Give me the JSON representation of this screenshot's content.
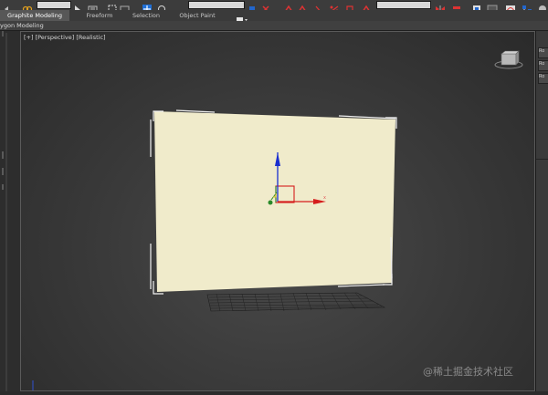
{
  "ribbon": {
    "tabs": [
      {
        "label": "Graphite Modeling Tools",
        "active": true
      },
      {
        "label": "Freeform",
        "active": false
      },
      {
        "label": "Selection",
        "active": false
      },
      {
        "label": "Object Paint",
        "active": false
      }
    ]
  },
  "subbar": {
    "label": "ygon Modeling"
  },
  "viewport": {
    "label": "[+] [Perspective] [Realistic]",
    "plane_color": "#f0ebcb",
    "grid_color": "#1e1e1e"
  },
  "gizmo": {
    "x_axis_label": "x",
    "x_color": "#d51d1d",
    "y_color": "#2a8a2a",
    "z_color": "#1a2fcf",
    "plane_color": "#e0c020"
  },
  "right_panel": {
    "buttons": [
      "Ro",
      "Ro",
      "Ro"
    ]
  },
  "watermark": "@稀土掘金技术社区",
  "accent_color": "#1f6fd6"
}
